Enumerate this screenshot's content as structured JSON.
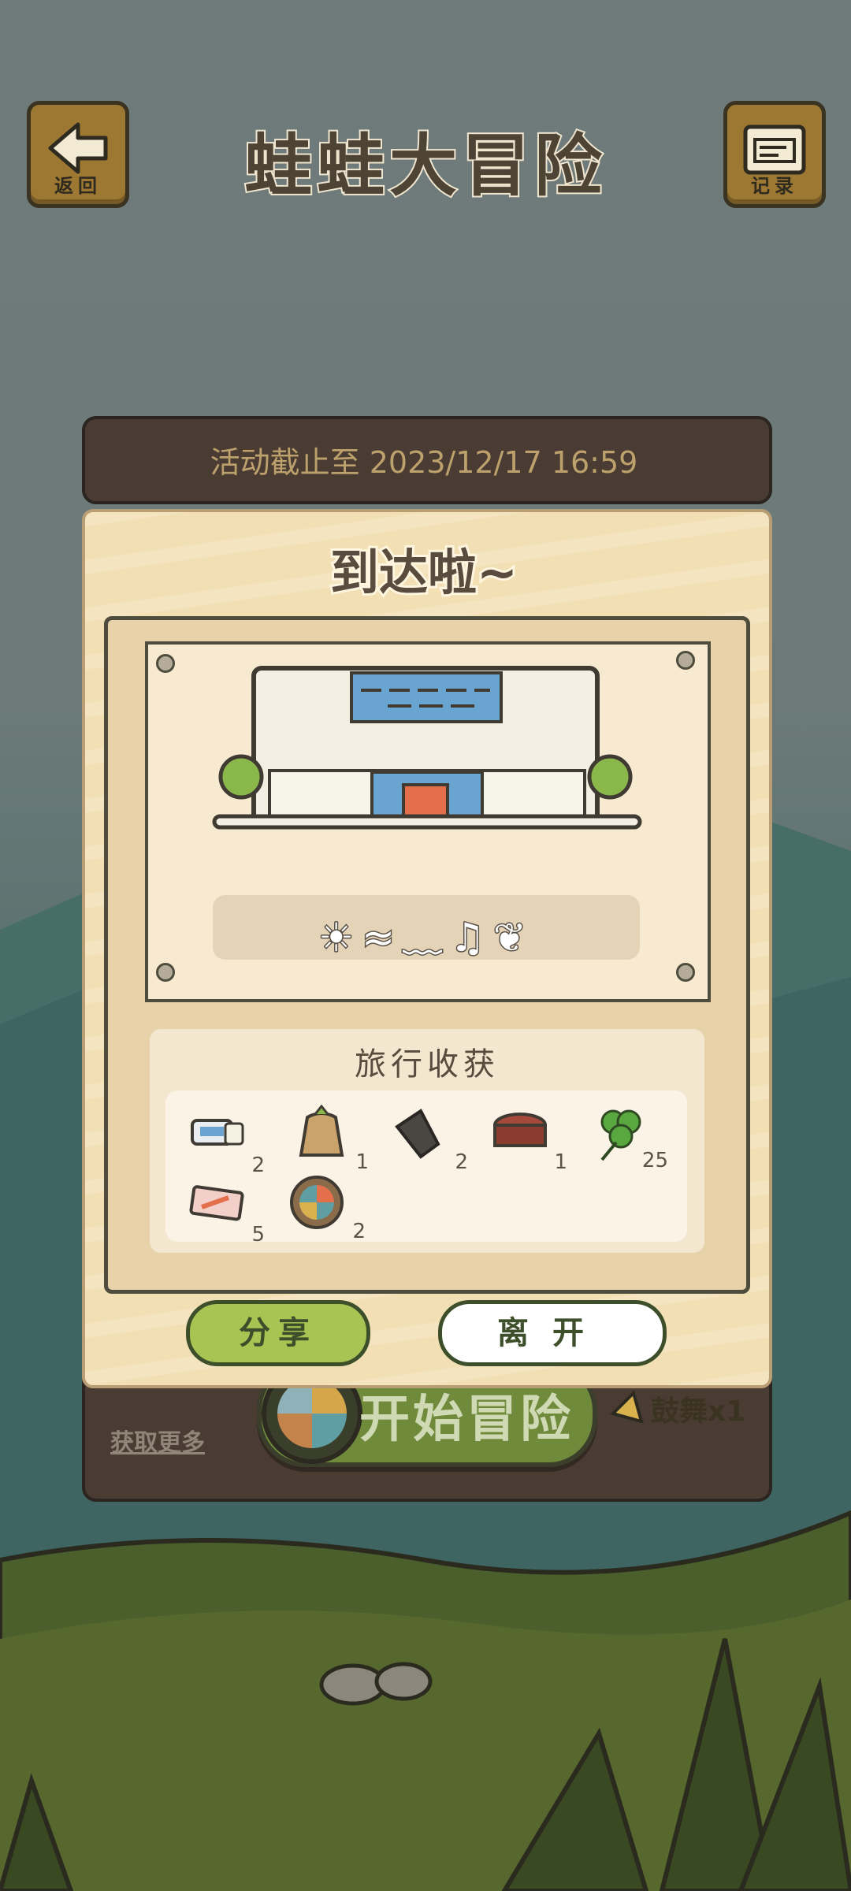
{
  "header": {
    "back_label": "返回",
    "title": "蛙蛙大冒险",
    "record_label": "记录"
  },
  "board": {
    "deadline": "活动截止至 2023/12/17 16:59",
    "get_more": "获取更多",
    "start_label": "开始冒险",
    "cheer_label": "鼓舞x1"
  },
  "card": {
    "title": "到达啦~",
    "poem_glyphs": "☀≈﹏♫❦",
    "loot_title": "旅行收获",
    "items": [
      {
        "icon": "ticket-icon",
        "count": "2"
      },
      {
        "icon": "seed-bag-icon",
        "count": "1"
      },
      {
        "icon": "charcoal-icon",
        "count": "2"
      },
      {
        "icon": "wood-log-icon",
        "count": "1"
      },
      {
        "icon": "clover-icon",
        "count": "25"
      },
      {
        "icon": "postcard-icon",
        "count": "5"
      },
      {
        "icon": "compass-wheel-icon",
        "count": "2"
      }
    ],
    "share_label": "分享",
    "leave_label": "离开"
  },
  "colors": {
    "accent_green": "#a8c453",
    "wood_dark": "#4a3b33",
    "card_bg": "#f2dfb4"
  }
}
